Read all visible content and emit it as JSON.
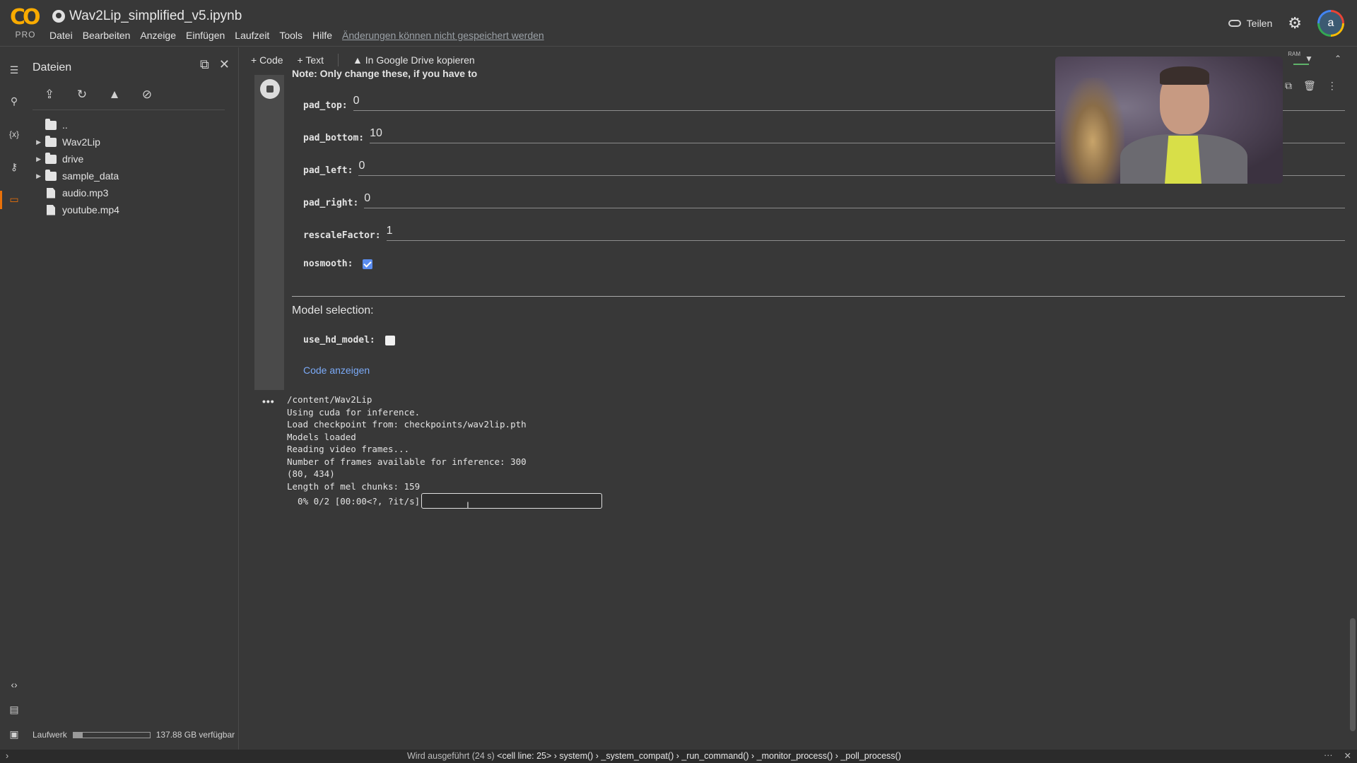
{
  "header": {
    "logo_text": "CO",
    "logo_sub": "PRO",
    "notebook_title": "Wav2Lip_simplified_v5.ipynb",
    "menu": [
      "Datei",
      "Bearbeiten",
      "Anzeige",
      "Einfügen",
      "Laufzeit",
      "Tools",
      "Hilfe"
    ],
    "save_warning": "Änderungen können nicht gespeichert werden",
    "share_label": "Teilen",
    "avatar_letter": "a"
  },
  "files_panel": {
    "title": "Dateien",
    "tree": [
      {
        "name": "..",
        "type": "parent"
      },
      {
        "name": "Wav2Lip",
        "type": "folder"
      },
      {
        "name": "drive",
        "type": "folder"
      },
      {
        "name": "sample_data",
        "type": "folder"
      },
      {
        "name": "audio.mp3",
        "type": "file"
      },
      {
        "name": "youtube.mp4",
        "type": "file"
      }
    ],
    "disk_label": "Laufwerk",
    "disk_free": "137.88 GB verfügbar",
    "disk_used_fraction": 0.12
  },
  "toolbar": {
    "add_code": "+ Code",
    "add_text": "+ Text",
    "copy_drive": "In Google Drive kopieren",
    "ram_label": "RAM"
  },
  "cell": {
    "note": "Note: Only change these, if you have to",
    "fields": [
      {
        "label": "pad_top:",
        "value": "0"
      },
      {
        "label": "pad_bottom:",
        "value": "10"
      },
      {
        "label": "pad_left:",
        "value": "0"
      },
      {
        "label": "pad_right:",
        "value": "0"
      },
      {
        "label": "rescaleFactor:",
        "value": "1"
      }
    ],
    "nosmooth_label": "nosmooth:",
    "nosmooth_checked": true,
    "model_section": "Model selection:",
    "use_hd_label": "use_hd_model:",
    "use_hd_checked": false,
    "show_code": "Code anzeigen"
  },
  "output": {
    "lines": [
      "/content/Wav2Lip",
      "Using cuda for inference.",
      "Load checkpoint from: checkpoints/wav2lip.pth",
      "Models loaded",
      "Reading video frames...",
      "Number of frames available for inference: 300",
      "(80, 434)",
      "Length of mel chunks: 159"
    ],
    "progress_text": "  0% 0/2 [00:00<?, ?it/s]",
    "progress_fraction": 0
  },
  "statusbar": {
    "text": "Wird ausgeführt (24 s)",
    "trace": "<cell line: 25> › system() › _system_compat() › _run_command() › _monitor_process() › _poll_process()"
  },
  "colors": {
    "background": "#383838",
    "accent_orange": "#e8710a",
    "logo_yellow": "#f9ab00",
    "link_blue": "#7baaf7",
    "checkbox_blue": "#5b8def"
  }
}
